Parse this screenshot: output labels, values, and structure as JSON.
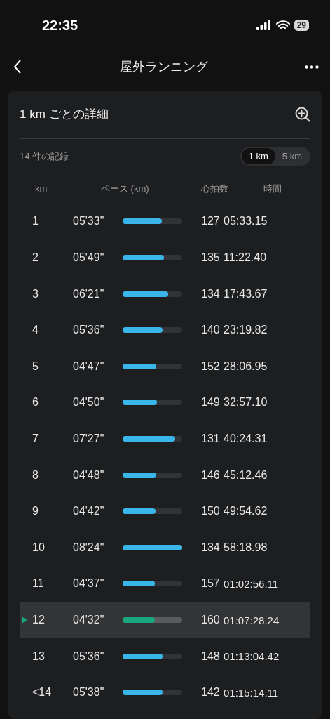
{
  "status_bar": {
    "time": "22:35",
    "battery": "29"
  },
  "nav": {
    "title": "屋外ランニング"
  },
  "card": {
    "title": "1 km ごとの詳細",
    "record_count": "14 件の記録",
    "segments": [
      {
        "label": "1 km",
        "selected": true
      },
      {
        "label": "5 km",
        "selected": false
      }
    ],
    "columns": [
      "km",
      "ペース (km)",
      "心拍数",
      "時間"
    ],
    "rows": [
      {
        "km": "1",
        "pace": "05'33\"",
        "level": 0.66,
        "heart_rate": "127",
        "time": "05:33.15",
        "selected": false
      },
      {
        "km": "2",
        "pace": "05'49\"",
        "level": 0.69,
        "heart_rate": "135",
        "time": "11:22.40",
        "selected": false
      },
      {
        "km": "3",
        "pace": "06'21\"",
        "level": 0.76,
        "heart_rate": "134",
        "time": "17:43.67",
        "selected": false
      },
      {
        "km": "4",
        "pace": "05'36\"",
        "level": 0.67,
        "heart_rate": "140",
        "time": "23:19.82",
        "selected": false
      },
      {
        "km": "5",
        "pace": "04'47\"",
        "level": 0.56,
        "heart_rate": "152",
        "time": "28:06.95",
        "selected": false
      },
      {
        "km": "6",
        "pace": "04'50\"",
        "level": 0.58,
        "heart_rate": "149",
        "time": "32:57.10",
        "selected": false
      },
      {
        "km": "7",
        "pace": "07'27\"",
        "level": 0.88,
        "heart_rate": "131",
        "time": "40:24.31",
        "selected": false
      },
      {
        "km": "8",
        "pace": "04'48\"",
        "level": 0.56,
        "heart_rate": "146",
        "time": "45:12.46",
        "selected": false
      },
      {
        "km": "9",
        "pace": "04'42\"",
        "level": 0.55,
        "heart_rate": "150",
        "time": "49:54.62",
        "selected": false
      },
      {
        "km": "10",
        "pace": "08'24\"",
        "level": 1.0,
        "heart_rate": "134",
        "time": "58:18.98",
        "selected": false
      },
      {
        "km": "11",
        "pace": "04'37\"",
        "level": 0.54,
        "heart_rate": "157",
        "time": "01:02:56.11",
        "selected": false
      },
      {
        "km": "12",
        "pace": "04'32\"",
        "level": 0.54,
        "heart_rate": "160",
        "time": "01:07:28.24",
        "selected": true
      },
      {
        "km": "13",
        "pace": "05'36\"",
        "level": 0.67,
        "heart_rate": "148",
        "time": "01:13:04.42",
        "selected": false
      },
      {
        "km": "<14",
        "pace": "05'38\"",
        "level": 0.67,
        "heart_rate": "142",
        "time": "01:15:14.11",
        "selected": false
      }
    ]
  }
}
